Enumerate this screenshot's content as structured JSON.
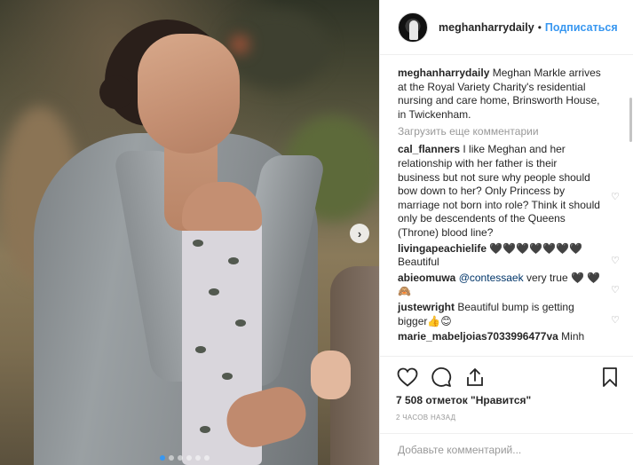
{
  "post": {
    "username": "meghanharrydaily",
    "follow_label": "Подписаться",
    "separator": "•"
  },
  "caption": {
    "user": "meghanharrydaily",
    "text": "Meghan Markle arrives at the Royal Variety Charity's residential nursing and care home, Brinsworth House, in Twickenham."
  },
  "load_more": "Загрузить еще комментарии",
  "comments": [
    {
      "user": "cal_flanners",
      "text": "I like Meghan and her relationship with her father is their business but not sure why people should bow down to her? Only Princess by marriage not born into role? Think it should only be descendents of the Queens (Throne) blood line?"
    },
    {
      "user": "livingapeachielife",
      "text": "🖤🖤🖤🖤🖤🖤🖤 Beautiful"
    },
    {
      "user": "abieomuwa",
      "mention": "@contessaek",
      "text": "very true 🖤 🖤🙈"
    },
    {
      "user": "justewright",
      "text": "Beautiful bump is getting bigger👍😊"
    },
    {
      "user": "marie_mabeljoias7033996477va",
      "text": "Minh"
    }
  ],
  "likes": "7 508 отметок \"Нравится\"",
  "time": "2 часов назад",
  "add_comment_placeholder": "Добавьте комментарий...",
  "icons": {
    "like": "heart-icon",
    "comment": "comment-icon",
    "share": "share-icon",
    "save": "bookmark-icon",
    "next": "chevron-right-icon"
  },
  "colors": {
    "link": "#3897f0",
    "text": "#262626",
    "muted": "#999999",
    "carousel_active_dot": "#3897f0"
  },
  "carousel": {
    "total_slides": 6,
    "active_index": 0
  }
}
